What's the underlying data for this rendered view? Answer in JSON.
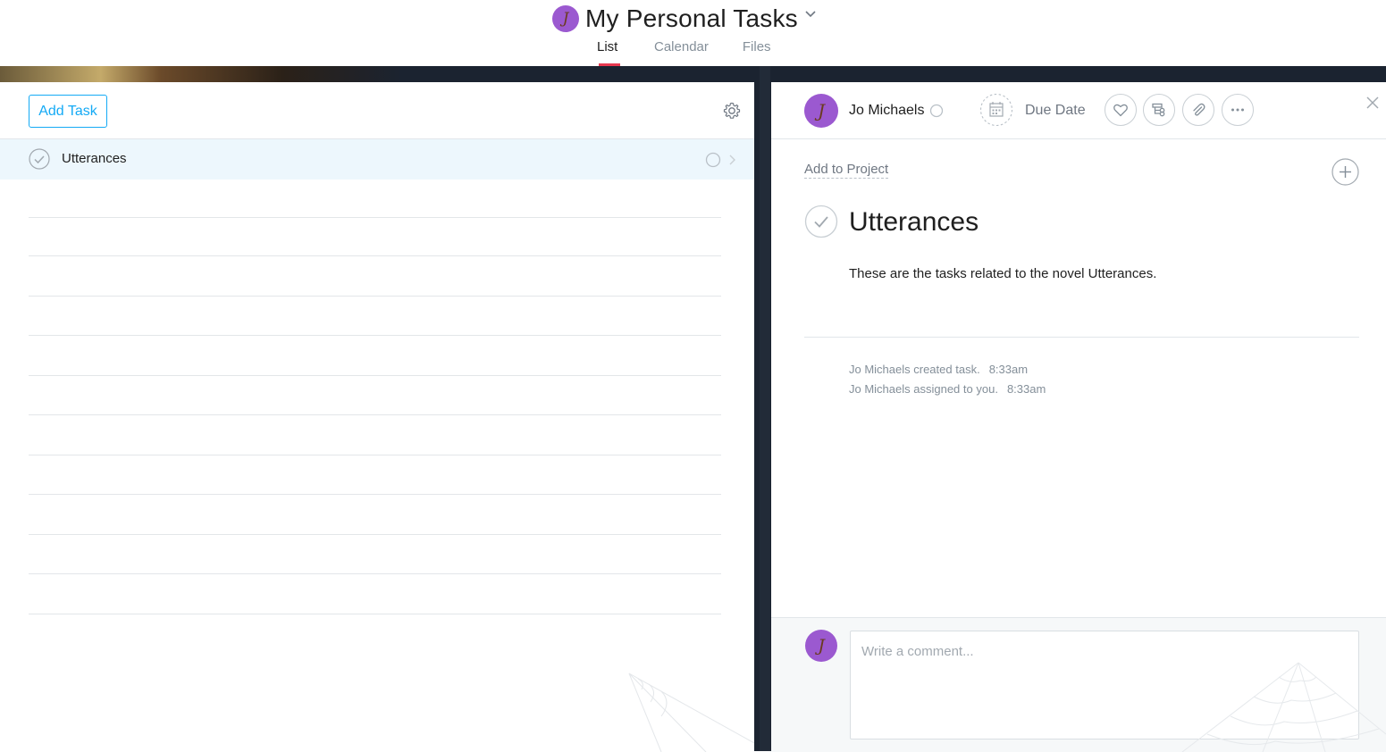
{
  "header": {
    "project_title": "My Personal Tasks",
    "tabs": [
      {
        "label": "List",
        "active": true
      },
      {
        "label": "Calendar",
        "active": false
      },
      {
        "label": "Files",
        "active": false
      }
    ]
  },
  "list": {
    "add_task_label": "Add Task",
    "tasks": [
      {
        "name": "Utterances",
        "selected": true,
        "completed": false
      }
    ]
  },
  "detail": {
    "assignee": "Jo Michaels",
    "due_date_label": "Due Date",
    "add_to_project_label": "Add to Project",
    "title": "Utterances",
    "description": "These are the tasks related to the novel Utterances.",
    "stories": [
      {
        "text": "Jo Michaels created task.",
        "time": "8:33am"
      },
      {
        "text": "Jo Michaels assigned to you.",
        "time": "8:33am"
      }
    ],
    "comment_placeholder": "Write a comment..."
  },
  "icons": {
    "gear": "gear-icon",
    "check": "check-circle-icon",
    "calendar": "calendar-icon",
    "heart": "heart-icon",
    "subtask": "subtask-icon",
    "attachment": "paperclip-icon",
    "more": "more-icon",
    "close": "close-icon",
    "plus": "plus-circle-icon"
  },
  "colors": {
    "accent": "#14aaf5",
    "tab_underline": "#e8384f",
    "avatar": "#9b59d0",
    "selected_row": "#edf7fd",
    "band": "#1b2330"
  }
}
